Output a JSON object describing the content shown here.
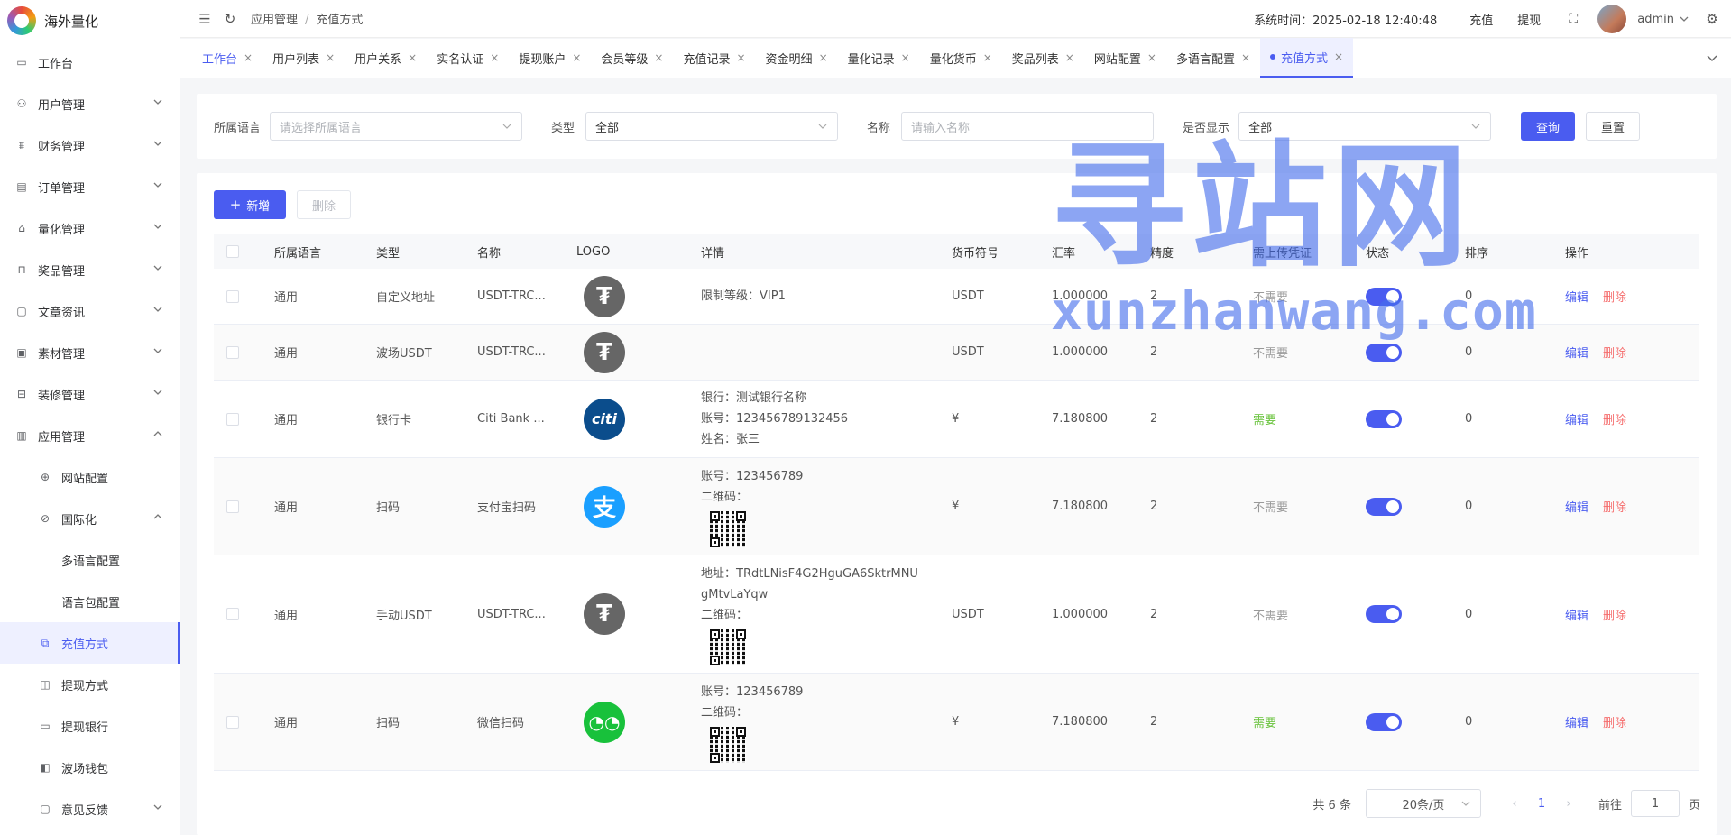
{
  "app": {
    "title": "海外量化"
  },
  "sidebar": {
    "items": [
      {
        "label": "工作台",
        "icon": "monitor-icon"
      },
      {
        "label": "用户管理",
        "icon": "user-icon"
      },
      {
        "label": "财务管理",
        "icon": "chart-icon"
      },
      {
        "label": "订单管理",
        "icon": "doc-icon"
      },
      {
        "label": "量化管理",
        "icon": "robot-icon"
      },
      {
        "label": "奖品管理",
        "icon": "bag-icon"
      },
      {
        "label": "文章资讯",
        "icon": "message-icon"
      },
      {
        "label": "素材管理",
        "icon": "image-icon"
      },
      {
        "label": "装修管理",
        "icon": "brush-icon"
      },
      {
        "label": "应用管理",
        "icon": "app-icon"
      },
      {
        "label": "网站配置",
        "icon": "globe-icon"
      },
      {
        "label": "国际化",
        "icon": "globe-alt-icon"
      },
      {
        "label": "多语言配置"
      },
      {
        "label": "语言包配置"
      },
      {
        "label": "充值方式",
        "icon": "recharge-icon"
      },
      {
        "label": "提现方式",
        "icon": "wallet-icon"
      },
      {
        "label": "提现银行",
        "icon": "card-icon"
      },
      {
        "label": "波场钱包",
        "icon": "purse-icon"
      },
      {
        "label": "意见反馈",
        "icon": "feedback-icon"
      }
    ]
  },
  "header": {
    "breadcrumb": [
      "应用管理",
      "充值方式"
    ],
    "system_time": "系统时间：2025-02-18 12:40:48",
    "recharge": "充值",
    "withdraw": "提现",
    "username": "admin"
  },
  "tabs": [
    "工作台",
    "用户列表",
    "用户关系",
    "实名认证",
    "提现账户",
    "会员等级",
    "充值记录",
    "资金明细",
    "量化记录",
    "量化货币",
    "奖品列表",
    "网站配置",
    "多语言配置",
    "充值方式"
  ],
  "filter": {
    "language_label": "所属语言",
    "language_placeholder": "请选择所属语言",
    "type_label": "类型",
    "type_value": "全部",
    "name_label": "名称",
    "name_placeholder": "请输入名称",
    "display_label": "是否显示",
    "display_value": "全部",
    "search_button": "查询",
    "reset_button": "重置"
  },
  "toolbar": {
    "add_button": "新增",
    "delete_button": "删除"
  },
  "table": {
    "headers": [
      "所属语言",
      "类型",
      "名称",
      "LOGO",
      "详情",
      "货币符号",
      "汇率",
      "精度",
      "需上传凭证",
      "状态",
      "排序",
      "操作"
    ],
    "edit_label": "编辑",
    "delete_label": "删除",
    "rows": [
      {
        "lang": "通用",
        "type": "自定义地址",
        "name": "USDT-TRC...",
        "logo": "tether",
        "details": [
          "限制等级：VIP1"
        ],
        "qr": false,
        "symbol": "USDT",
        "rate": "1.000000",
        "precision": "2",
        "voucher": "不需要",
        "voucher_required": false,
        "status_on": true,
        "sort": "0"
      },
      {
        "lang": "通用",
        "type": "波场USDT",
        "name": "USDT-TRC...",
        "logo": "tether",
        "details": [],
        "qr": false,
        "symbol": "USDT",
        "rate": "1.000000",
        "precision": "2",
        "voucher": "不需要",
        "voucher_required": false,
        "status_on": true,
        "sort": "0"
      },
      {
        "lang": "通用",
        "type": "银行卡",
        "name": "Citi Bank ...",
        "logo": "citi",
        "details": [
          "银行：测试银行名称",
          "账号：123456789132456",
          "姓名：张三"
        ],
        "qr": false,
        "symbol": "¥",
        "rate": "7.180800",
        "precision": "2",
        "voucher": "需要",
        "voucher_required": true,
        "status_on": true,
        "sort": "0"
      },
      {
        "lang": "通用",
        "type": "扫码",
        "name": "支付宝扫码",
        "logo": "alipay",
        "details": [
          "账号：123456789",
          "二维码："
        ],
        "qr": true,
        "symbol": "¥",
        "rate": "7.180800",
        "precision": "2",
        "voucher": "不需要",
        "voucher_required": false,
        "status_on": true,
        "sort": "0"
      },
      {
        "lang": "通用",
        "type": "手动USDT",
        "name": "USDT-TRC...",
        "logo": "tether",
        "details": [
          "地址：TRdtLNisF4G2HguGA6SktrMNU",
          "gMtvLaYqw",
          "二维码："
        ],
        "qr": true,
        "symbol": "USDT",
        "rate": "1.000000",
        "precision": "2",
        "voucher": "不需要",
        "voucher_required": false,
        "status_on": true,
        "sort": "0"
      },
      {
        "lang": "通用",
        "type": "扫码",
        "name": "微信扫码",
        "logo": "wechat",
        "details": [
          "账号：123456789",
          "二维码："
        ],
        "qr": true,
        "symbol": "¥",
        "rate": "7.180800",
        "precision": "2",
        "voucher": "需要",
        "voucher_required": true,
        "status_on": true,
        "sort": "0"
      }
    ]
  },
  "pagination": {
    "total": "共 6 条",
    "page_size": "20条/页",
    "current_page": "1",
    "goto_prefix": "前往",
    "goto_value": "1",
    "goto_suffix": "页"
  },
  "watermark": {
    "title": "寻站网",
    "url": "xunzhanwang.com"
  },
  "colors": {
    "accent": "#4a5cf0",
    "danger": "#f56c6c",
    "success": "#67c23a"
  }
}
